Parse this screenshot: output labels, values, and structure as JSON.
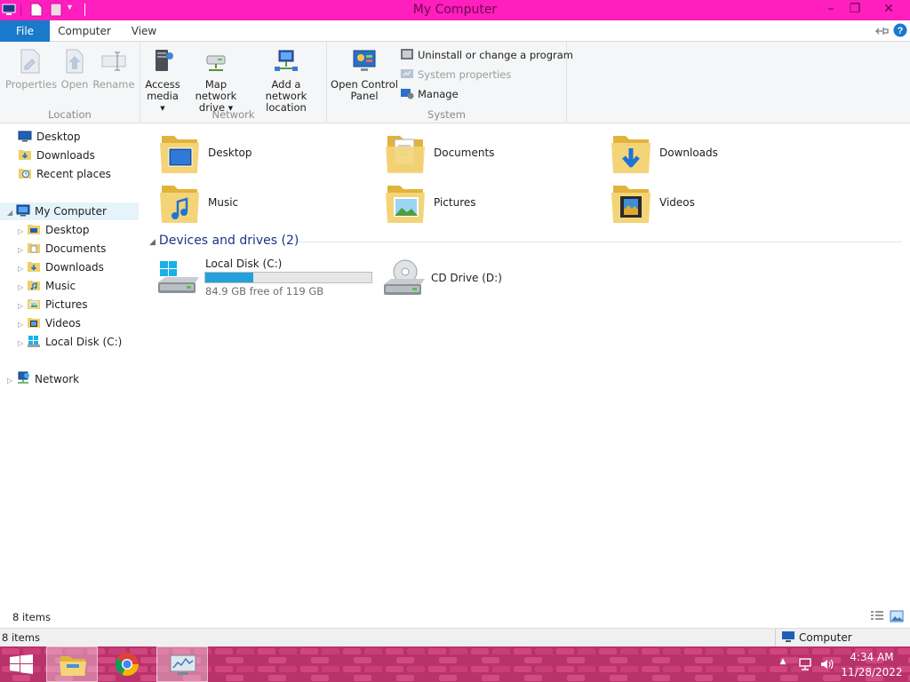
{
  "window": {
    "title": "My Computer",
    "controls": {
      "minimize": "–",
      "maximize": "❐",
      "close": "✕"
    }
  },
  "ribbon_tabs": [
    {
      "label": "File"
    },
    {
      "label": "Computer"
    },
    {
      "label": "View"
    }
  ],
  "ribbon": {
    "location": {
      "label": "Location",
      "properties": "Properties",
      "open": "Open",
      "rename": "Rename"
    },
    "network": {
      "label": "Network",
      "access_media_1": "Access",
      "access_media_2": "media",
      "map_drive_1": "Map network",
      "map_drive_2": "drive",
      "add_location_1": "Add a network",
      "add_location_2": "location"
    },
    "system": {
      "label": "System",
      "control_panel_1": "Open Control",
      "control_panel_2": "Panel",
      "uninstall": "Uninstall or change a program",
      "system_properties": "System properties",
      "manage": "Manage"
    }
  },
  "nav": {
    "favorites": [
      "Desktop",
      "Downloads",
      "Recent places"
    ],
    "computer": "My Computer",
    "computer_children": [
      "Desktop",
      "Documents",
      "Downloads",
      "Music",
      "Pictures",
      "Videos",
      "Local Disk (C:)"
    ],
    "network": "Network"
  },
  "folders": [
    "Desktop",
    "Documents",
    "Downloads",
    "Music",
    "Pictures",
    "Videos"
  ],
  "devices": {
    "header": "Devices and drives (2)",
    "local_disk": {
      "name": "Local Disk (C:)",
      "free_text": "84.9 GB free of 119 GB",
      "used_fraction": 0.287
    },
    "cd_drive": {
      "name": "CD Drive (D:)"
    }
  },
  "status": {
    "items": "8 items",
    "items_bottom": "8 items",
    "computer": "Computer"
  },
  "taskbar": {
    "time": "4:34 AM",
    "date": "11/28/2022",
    "show_hidden": "▲"
  },
  "colors": {
    "titlebar": "#ff1ebe",
    "accent": "#1979ca",
    "taskbar": "#b8336a"
  }
}
